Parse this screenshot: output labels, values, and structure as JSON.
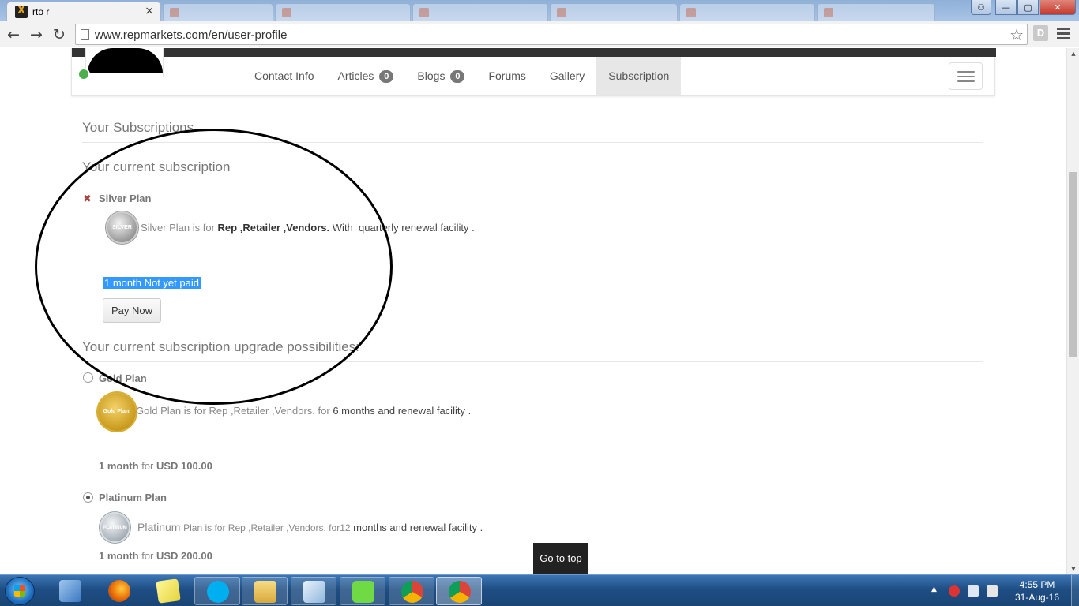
{
  "browser": {
    "tab_title": "rto r",
    "tab_close": "×",
    "url": "www.repmarkets.com/en/user-profile",
    "back": "←",
    "forward": "→",
    "reload": "↻",
    "bookmark_star": "☆",
    "extension_letter": "D",
    "window_buttons": {
      "minimize": "—",
      "maximize": "▢",
      "close": "✕"
    }
  },
  "profile_tabs": [
    {
      "label": "Contact Info"
    },
    {
      "label": "Articles",
      "badge": "0"
    },
    {
      "label": "Blogs",
      "badge": "0"
    },
    {
      "label": "Forums"
    },
    {
      "label": "Gallery"
    },
    {
      "label": "Subscription",
      "active": true
    }
  ],
  "subscriptions": {
    "title": "Your Subscriptions",
    "current_title": "Your current subscription",
    "current_plan": {
      "status_icon": "✖",
      "name": "Silver Plan",
      "medal_label": "SILVER",
      "desc_prefix": "Silver Plan is for",
      "desc_roles": "Rep ,Retailer ,Vendors.",
      "desc_with": "With",
      "desc_facility": "quarterly renewal facility",
      "desc_end": ".",
      "selected_text": "1 month Not yet paid",
      "pay_button": "Pay Now"
    },
    "upgrade_title": "Your current subscription upgrade possibilities:",
    "upgrades": [
      {
        "name": "Gold Plan",
        "medal_label": "Gold Plan!",
        "desc_prefix": "Gold Plan is for Rep ,Retailer ,Vendors. for",
        "desc_facility": "6 months and renewal facility",
        "desc_end": ".",
        "price_duration": "1 month",
        "price_for": "for",
        "price_amount": "USD 100.00",
        "selected": false
      },
      {
        "name": "Platinum Plan",
        "medal_label": "PLATINUM",
        "desc_prefix_big": "Platinum",
        "desc_prefix": "Plan is for Rep ,Retailer ,Vendors. for12",
        "desc_facility": "months and renewal facility",
        "desc_end": ".",
        "price_duration": "1 month",
        "price_for": "for",
        "price_amount": "USD 200.00",
        "selected": true
      }
    ]
  },
  "go_to_top": "Go to top",
  "taskbar": {
    "apps": [
      "start",
      "virtualbox",
      "firefox",
      "sticky-notes",
      "skype",
      "file-explorer",
      "notepad",
      "upwork",
      "chrome",
      "chrome-active"
    ],
    "time": "4:55 PM",
    "date": "31-Aug-16"
  },
  "colors": {
    "selection": "#3399ff",
    "online": "#4cae4c",
    "error_x": "#a94442",
    "taskbar": "#1f4e84"
  }
}
